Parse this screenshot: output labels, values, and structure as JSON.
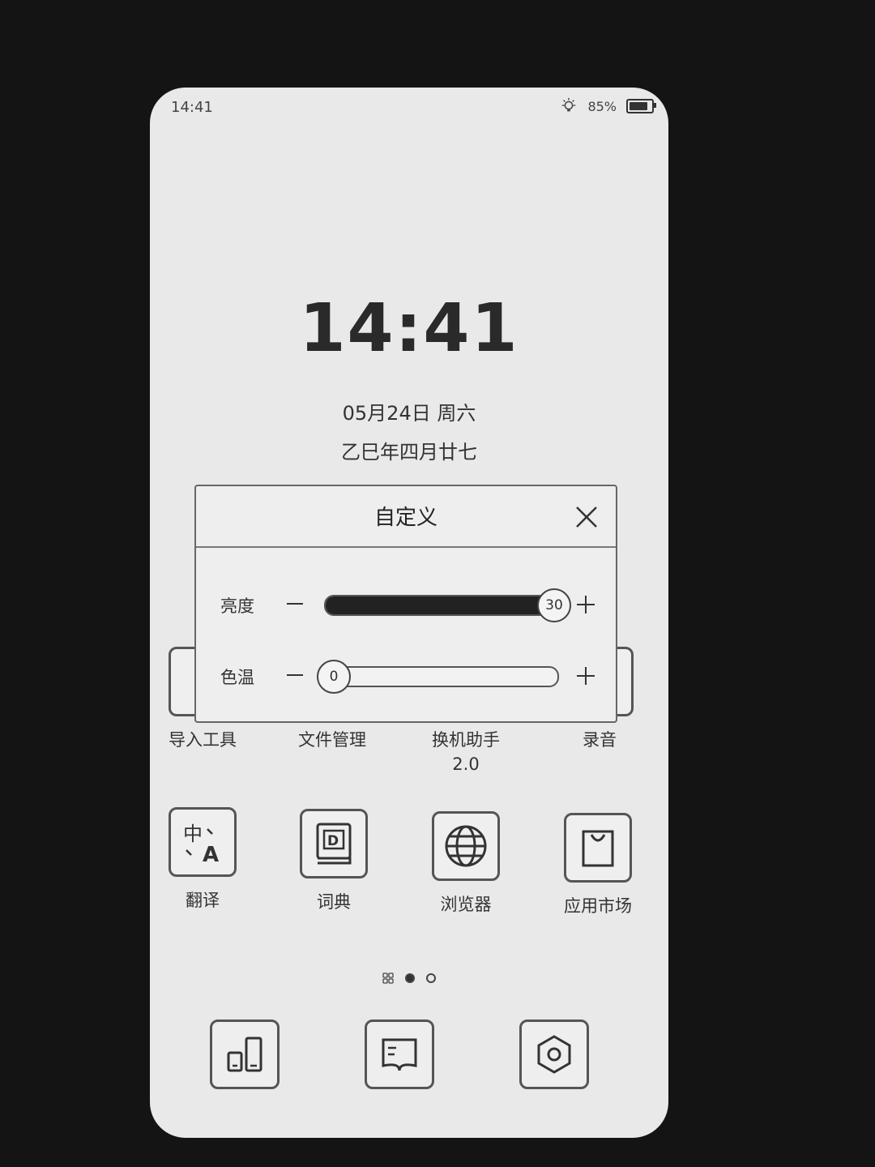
{
  "status_bar": {
    "time": "14:41",
    "battery_text": "85%",
    "battery_level": 0.85,
    "icons": [
      "bulb-icon",
      "battery-icon"
    ]
  },
  "lockscreen": {
    "time": "14:41",
    "date": "05月24日 周六",
    "lunar_date": "乙巳年四月廿七"
  },
  "hidden_apps": [
    {
      "label": "导入工具"
    },
    {
      "label": "文件管理"
    },
    {
      "label": "换机助手\n2.0"
    },
    {
      "label": "录音"
    }
  ],
  "apps": [
    {
      "label": "翻译",
      "icon": "translate-icon"
    },
    {
      "label": "词典",
      "icon": "dictionary-icon"
    },
    {
      "label": "浏览器",
      "icon": "globe-icon"
    },
    {
      "label": "应用市场",
      "icon": "shopping-bag-icon"
    }
  ],
  "dialog": {
    "title": "自定义",
    "brightness": {
      "label": "亮度",
      "value": "30",
      "level": 1.0
    },
    "color_temp": {
      "label": "色温",
      "value": "0",
      "level": 0.0
    }
  },
  "pager": {
    "pages": 2,
    "active": 0
  },
  "dock": [
    {
      "icon": "devices-icon"
    },
    {
      "icon": "book-icon"
    },
    {
      "icon": "settings-hex-icon"
    }
  ]
}
